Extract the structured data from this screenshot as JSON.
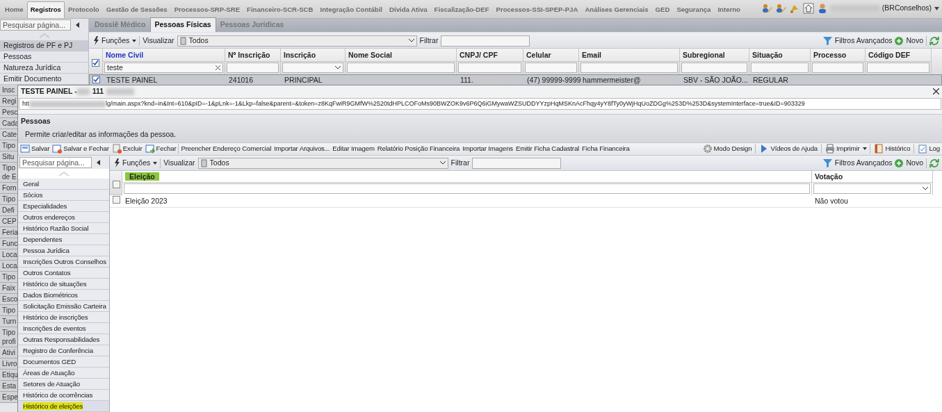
{
  "top_menu": [
    {
      "label": "Home",
      "selected": false
    },
    {
      "label": "Registros",
      "selected": true
    },
    {
      "label": "Protocolo",
      "selected": false
    },
    {
      "label": "Gestão de Sessões",
      "selected": false
    },
    {
      "label": "Processos-SRP-SRE",
      "selected": false
    },
    {
      "label": "Financeiro-SCR-SCB",
      "selected": false
    },
    {
      "label": "Integração Contábil",
      "selected": false
    },
    {
      "label": "Dívida Ativa",
      "selected": false
    },
    {
      "label": "Fiscalização-DEF",
      "selected": false
    },
    {
      "label": "Processos-SSI-SPEP-PJA",
      "selected": false
    },
    {
      "label": "Análises Gerenciais",
      "selected": false
    },
    {
      "label": "GED",
      "selected": false
    },
    {
      "label": "Segurança",
      "selected": false
    },
    {
      "label": "Interno",
      "selected": false
    }
  ],
  "user": {
    "name_redacted": true,
    "org": "(BRConselhos)"
  },
  "sidebar": {
    "search": {
      "placeholder": "Pesquisar página..."
    },
    "items": [
      {
        "label": "Registros de PF e PJ",
        "selected": true
      },
      {
        "label": "Pessoas",
        "selected": false
      },
      {
        "label": "Natureza Jurídica",
        "selected": false
      },
      {
        "label": "Emitir Documento",
        "selected": false
      }
    ],
    "partial_items": [
      "Insc",
      "Regi",
      "Pesc",
      "Cada",
      "Cate",
      "Tipo",
      "Situ",
      "Tipo de E",
      "Forn",
      "Tipo",
      "Defi",
      "CEP",
      "Feria",
      "Func",
      "Loca",
      "Loca",
      "Tipo",
      "Faix",
      "Esco",
      "Tipo",
      "Turn",
      "Tipo profi",
      "Ativi",
      "Livro",
      "Etiqu",
      "Esta",
      "Espe"
    ]
  },
  "tabs": [
    {
      "label": "Dossiê Médico",
      "selected": false
    },
    {
      "label": "Pessoas Físicas",
      "selected": true
    },
    {
      "label": "Pessoas Jurídicas",
      "selected": false
    }
  ],
  "toolbar": {
    "functions": "Funções",
    "view_label": "Visualizar",
    "view_value": "Todos",
    "filter_label": "Filtrar",
    "advanced_filters": "Filtros Avançados",
    "new": "Novo"
  },
  "grid": {
    "select_all_checked": true,
    "columns": [
      {
        "label": "Nome Civil",
        "sorted": true,
        "filter": "teste",
        "kind": "clear"
      },
      {
        "label": "Nº Inscrição",
        "sorted": false,
        "kind": "text"
      },
      {
        "label": "Inscrição",
        "sorted": false,
        "kind": "select"
      },
      {
        "label": "Nome Social",
        "sorted": false,
        "kind": "text"
      },
      {
        "label": "CNPJ/ CPF",
        "sorted": false,
        "kind": "text"
      },
      {
        "label": "Celular",
        "sorted": false,
        "kind": "text"
      },
      {
        "label": "Email",
        "sorted": false,
        "kind": "text"
      },
      {
        "label": "Subregional",
        "sorted": false,
        "kind": "text"
      },
      {
        "label": "Situação",
        "sorted": false,
        "kind": "text"
      },
      {
        "label": "Processo",
        "sorted": false,
        "kind": "text"
      },
      {
        "label": "Código DEF",
        "sorted": false,
        "kind": "text"
      }
    ],
    "rows": [
      {
        "selected": true,
        "cells": [
          {
            "text": "TESTE PAINEL",
            "redacted": false
          },
          {
            "text": "241016",
            "redacted": false
          },
          {
            "text": "PRINCIPAL",
            "redacted": false
          },
          null,
          {
            "text": "111.",
            "redacted": true
          },
          {
            "text": "(47) 99999-9999",
            "redacted": false
          },
          {
            "text": "hammermeister@",
            "redacted": true
          },
          {
            "text": "SBV - SÃO JOÃO...",
            "redacted": false
          },
          {
            "text": "REGULAR",
            "redacted": false
          },
          null,
          null
        ]
      }
    ]
  },
  "dialog": {
    "title": "TESTE PAINEL -",
    "title_part": "111",
    "url_start": "htt",
    "url_rest": "lg/main.aspx?knd=in&Int=610&pID=-1&pLnk=-1&Lkp=false&parent=&token=z8KqFwiR9GMfW%2520tdHPLCOFoMs90BWZOK9v6P6Q6iGMywaWZSUDDYYzpHqMSKnAcFhqy4yY8fTy0yWjHqUoZDGg%253D%253D&systemInterface=true&ID=903329",
    "header": {
      "title": "Pessoas",
      "description": "Permite criar/editar as informações da pessoa."
    },
    "actions": [
      {
        "label": "Salvar",
        "kind": "save"
      },
      {
        "label": "Salvar e Fechar",
        "kind": "save_close"
      },
      {
        "label": "Excluir",
        "kind": "delete"
      },
      {
        "label": "Fechar",
        "kind": "close"
      },
      {
        "label": "Preencher Endereço Comercial",
        "kind": "text"
      },
      {
        "label": "Importar Arquivos...",
        "kind": "text"
      },
      {
        "label": "Editar Imagem",
        "kind": "text"
      },
      {
        "label": "Relatório Posição Financeira",
        "kind": "text"
      },
      {
        "label": "Importar Imagens",
        "kind": "text"
      },
      {
        "label": "Emitir Ficha Cadastral",
        "kind": "text"
      },
      {
        "label": "Ficha Financeira",
        "kind": "text"
      }
    ],
    "right_actions": [
      {
        "label": "Modo Design",
        "kind": "design"
      },
      {
        "label": "Vídeos de Ajuda",
        "kind": "video"
      },
      {
        "label": "Imprimir",
        "kind": "print"
      },
      {
        "label": "Histórico",
        "kind": "history"
      },
      {
        "label": "Log",
        "kind": "log"
      }
    ],
    "sidebar": {
      "search": {
        "placeholder": "Pesquisar página..."
      },
      "items": [
        {
          "label": "Geral",
          "selected": false
        },
        {
          "label": "Sócios",
          "selected": false
        },
        {
          "label": "Especialidades",
          "selected": false
        },
        {
          "label": "Outros endereços",
          "selected": false
        },
        {
          "label": "Histórico Razão Social",
          "selected": false
        },
        {
          "label": "Dependentes",
          "selected": false
        },
        {
          "label": "Pessoa Jurídica",
          "selected": false
        },
        {
          "label": "Inscrições Outros Conselhos",
          "selected": false
        },
        {
          "label": "Outros Contatos",
          "selected": false
        },
        {
          "label": "Histórico de situações",
          "selected": false
        },
        {
          "label": "Dados Biométricos",
          "selected": false
        },
        {
          "label": "Solicitação Emissão Carteira",
          "selected": false
        },
        {
          "label": "Histórico de inscrições",
          "selected": false
        },
        {
          "label": "Inscrições de eventos",
          "selected": false
        },
        {
          "label": "Outras Responsabilidades",
          "selected": false
        },
        {
          "label": "Registro de Conferência",
          "selected": false
        },
        {
          "label": "Documentos GED",
          "selected": false
        },
        {
          "label": "Áreas de Atuação",
          "selected": false
        },
        {
          "label": "Setores de Atuação",
          "selected": false
        },
        {
          "label": "Histórico de ocorrências",
          "selected": false
        },
        {
          "label": "Histórico de eleições",
          "selected": true
        }
      ]
    },
    "toolbar": {
      "functions": "Funções",
      "view_label": "Visualizar",
      "view_value": "Todos",
      "filter_label": "Filtrar",
      "advanced_filters": "Filtros Avançados",
      "new": "Novo"
    },
    "grid": {
      "select_all_checked": false,
      "columns": [
        {
          "label": "Eleição",
          "highlighted": true,
          "kind": "text"
        },
        {
          "label": "Votação",
          "highlighted": false,
          "kind": "select"
        }
      ],
      "rows": [
        {
          "selected": false,
          "cells": [
            "Eleição 2023",
            "Não votou"
          ]
        }
      ]
    }
  }
}
